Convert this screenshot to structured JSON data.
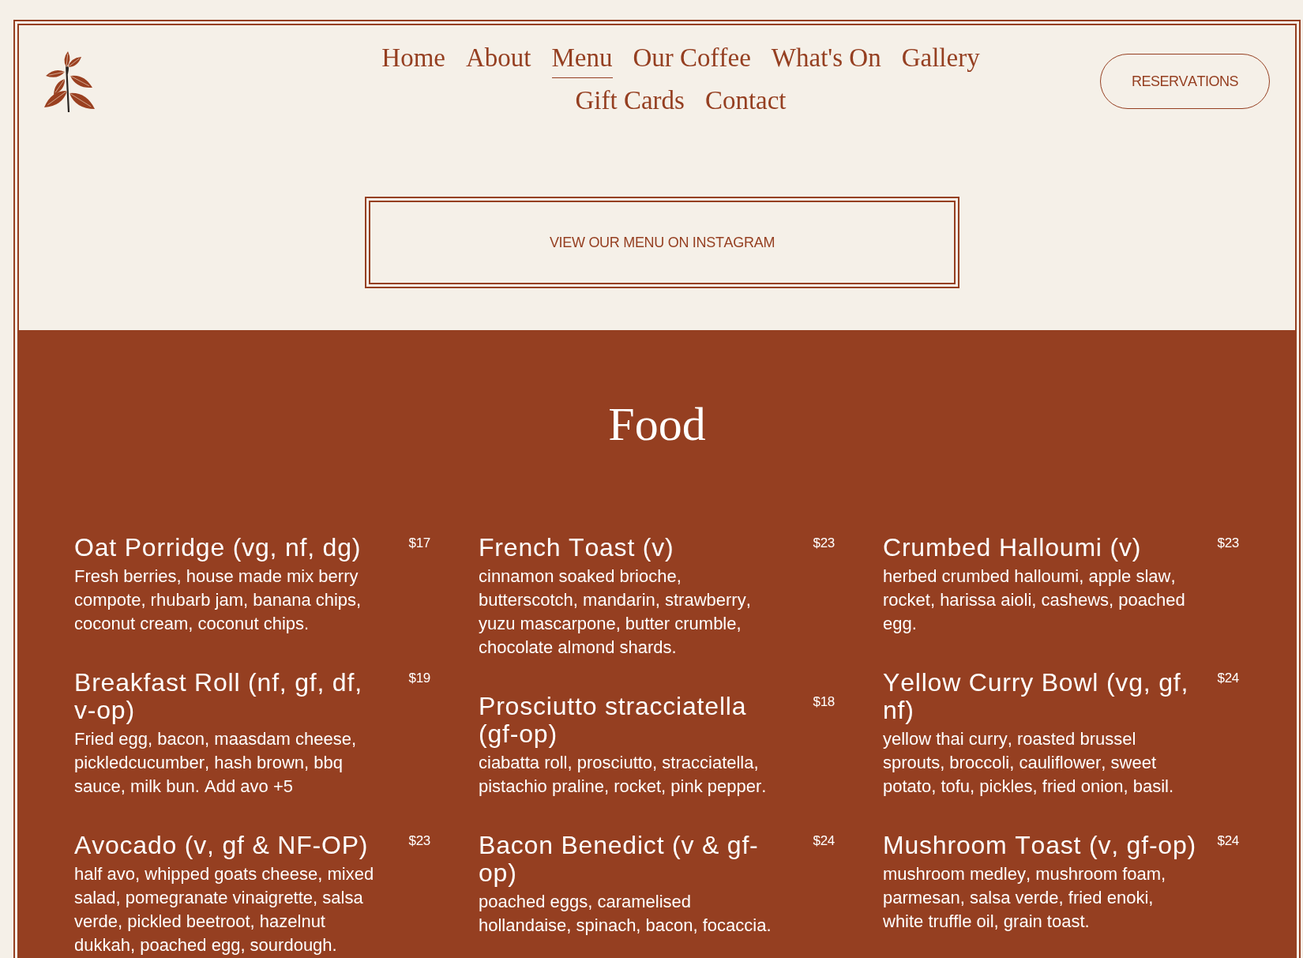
{
  "nav": {
    "items": [
      {
        "label": "Home",
        "selected": false
      },
      {
        "label": "About",
        "selected": false
      },
      {
        "label": "Menu",
        "selected": true
      },
      {
        "label": "Our Coffee",
        "selected": false
      },
      {
        "label": "What's On",
        "selected": false
      },
      {
        "label": "Gallery",
        "selected": false
      },
      {
        "label": "Gift Cards",
        "selected": false
      },
      {
        "label": "Contact",
        "selected": false
      }
    ]
  },
  "reservations_button": {
    "label": "RESERVATIONS"
  },
  "instagram_button": {
    "label": "VIEW OUR MENU ON INSTAGRAM"
  },
  "menu_section": {
    "heading": "Food",
    "columns": [
      {
        "items": [
          {
            "name": "Oat Porridge (vg, nf, dg)",
            "price": "$17",
            "description": "Fresh berries, house made mix berry compote, rhubarb jam, banana chips, coconut cream, coconut chips."
          },
          {
            "name": "Breakfast Roll (nf, gf, df, v-op)",
            "price": "$19",
            "description": "Fried egg, bacon, maasdam cheese, pickledcucumber, hash brown, bbq sauce, milk bun. Add avo +5"
          },
          {
            "name": "Avocado (v, gf & NF-OP)",
            "price": "$23",
            "description": "half avo, whipped goats cheese, mixed salad, pomegranate vinaigrette, salsa verde, pickled beetroot, hazelnut dukkah, poached egg, sourdough."
          }
        ]
      },
      {
        "items": [
          {
            "name": "French Toast (v)",
            "price": "$23",
            "description": "cinnamon soaked brioche, butterscotch, mandarin, strawberry, yuzu mascarpone, butter crumble, chocolate almond shards."
          },
          {
            "name": "Prosciutto stracciatella (gf-op)",
            "price": "$18",
            "description": "ciabatta roll, prosciutto, stracciatella, pistachio praline, rocket, pink pepper."
          },
          {
            "name": "Bacon Benedict (v & gf-op)",
            "price": "$24",
            "description": "poached eggs, caramelised hollandaise, spinach, bacon, focaccia."
          }
        ]
      },
      {
        "items": [
          {
            "name": "Crumbed Halloumi (v)",
            "price": "$23",
            "description": "herbed crumbed halloumi, apple slaw, rocket, harissa aioli, cashews, poached egg."
          },
          {
            "name": "Yellow Curry Bowl (vg, gf, nf)",
            "price": "$24",
            "description": "yellow thai curry, roasted brussel sprouts, broccoli, cauliflower, sweet potato, tofu, pickles, fried onion, basil."
          },
          {
            "name": "Mushroom Toast (v, gf-op)",
            "price": "$24",
            "description": "mushroom medley, mushroom foam, parmesan, salsa verde, fried enoki, white truffle oil, grain toast."
          }
        ]
      }
    ]
  }
}
